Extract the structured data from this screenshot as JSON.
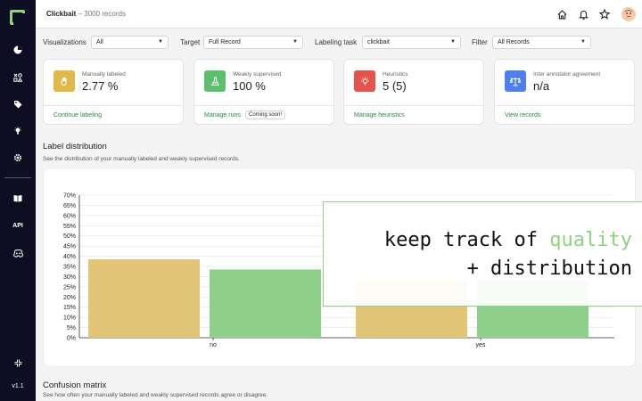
{
  "sidebar": {
    "api_label": "API",
    "version": "v1.1"
  },
  "topbar": {
    "project": "Clickbait",
    "records": "3000 records"
  },
  "filters": [
    {
      "label": "Visualizations",
      "value": "All"
    },
    {
      "label": "Target",
      "value": "Full Record"
    },
    {
      "label": "Labeling task",
      "value": "clickbait"
    },
    {
      "label": "Filter",
      "value": "All Records"
    }
  ],
  "cards": [
    {
      "label": "Manually labeled",
      "value": "2.77 %",
      "link": "Continue labeling",
      "icon": "hand-icon",
      "color": "#e3b84a"
    },
    {
      "label": "Weakly supervised",
      "value": "100 %",
      "link": "Manage runs",
      "badge": "Coming soon!",
      "icon": "flask-icon",
      "color": "#5cbf6c"
    },
    {
      "label": "Heuristics",
      "value": "5 (5)",
      "link": "Manage heuristics",
      "icon": "lightbulb-icon",
      "color": "#e5534b"
    },
    {
      "label": "Inter annotator agreement",
      "value": "n/a",
      "link": "View records",
      "icon": "scale-icon",
      "color": "#4f7ef0"
    }
  ],
  "label_distribution": {
    "title": "Label distribution",
    "description": "See the distribution of your manually labeled and weakly supervised records."
  },
  "confusion_matrix": {
    "title": "Confusion matrix",
    "description": "See how often your manually labeled and weakly supervised records agree or disagree."
  },
  "overlay": {
    "line1_prefix": "keep track of ",
    "line1_highlight": "quality",
    "line2": "+ distribution"
  },
  "chart_data": {
    "type": "bar",
    "categories": [
      "no",
      "yes"
    ],
    "series": [
      {
        "values": [
          38.5,
          28
        ],
        "color": "#e3c577"
      },
      {
        "values": [
          33.5,
          28
        ],
        "color": "#8ed08a"
      }
    ],
    "ylim": [
      0,
      70
    ],
    "yticks": [
      "0%",
      "5%",
      "10%",
      "15%",
      "20%",
      "25%",
      "30%",
      "35%",
      "40%",
      "45%",
      "50%",
      "55%",
      "60%",
      "65%",
      "70%"
    ],
    "grid": true
  }
}
